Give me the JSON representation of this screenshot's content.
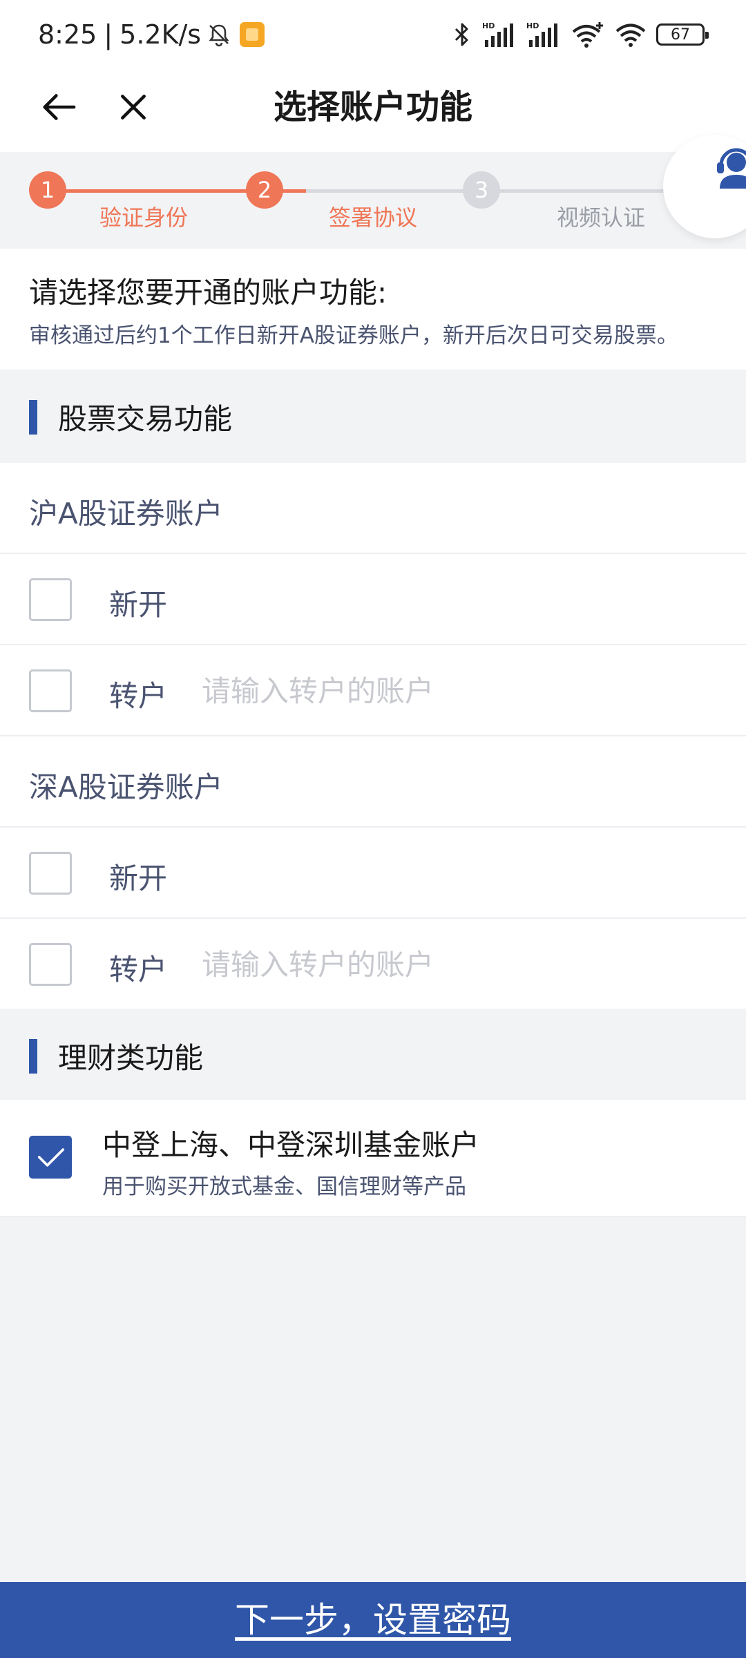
{
  "status_bar": {
    "time": "8:25",
    "separator": "|",
    "net_speed": "5.2K/s",
    "battery": "67",
    "icons": [
      "bell-muted-icon",
      "app-notification-icon",
      "bluetooth-icon",
      "signal-hd-icon",
      "signal-hd-icon",
      "wifi-icon",
      "wifi-plus-icon",
      "battery-icon"
    ]
  },
  "nav": {
    "back_icon": "arrow-left-icon",
    "close_icon": "close-icon",
    "title": "选择账户功能"
  },
  "stepper": {
    "active_color": "#ef7656",
    "inactive_color": "#d6d8dd",
    "steps": [
      {
        "number": "1",
        "label": "验证身份",
        "state": "done"
      },
      {
        "number": "2",
        "label": "签署协议",
        "state": "active"
      },
      {
        "number": "3",
        "label": "视频认证",
        "state": "pending"
      }
    ],
    "support_icon": "customer-service-icon"
  },
  "intro": {
    "title": "请选择您要开通的账户功能:",
    "subtitle": "审核通过后约1个工作日新开A股证券账户，新开后次日可交易股票。"
  },
  "sections": {
    "stock": {
      "title": "股票交易功能",
      "sh": {
        "title": "沪A股证券账户",
        "new_label": "新开",
        "new_checked": false,
        "transfer_label": "转户",
        "transfer_checked": false,
        "transfer_placeholder": "请输入转户的账户"
      },
      "sz": {
        "title": "深A股证券账户",
        "new_label": "新开",
        "new_checked": false,
        "transfer_label": "转户",
        "transfer_checked": false,
        "transfer_placeholder": "请输入转户的账户"
      }
    },
    "wealth": {
      "title": "理财类功能",
      "fund": {
        "title": "中登上海、中登深圳基金账户",
        "subtitle": "用于购买开放式基金、国信理财等产品",
        "checked": true
      }
    }
  },
  "footer": {
    "next_label": "下一步，设置密码",
    "button_color": "#2f56a8"
  }
}
